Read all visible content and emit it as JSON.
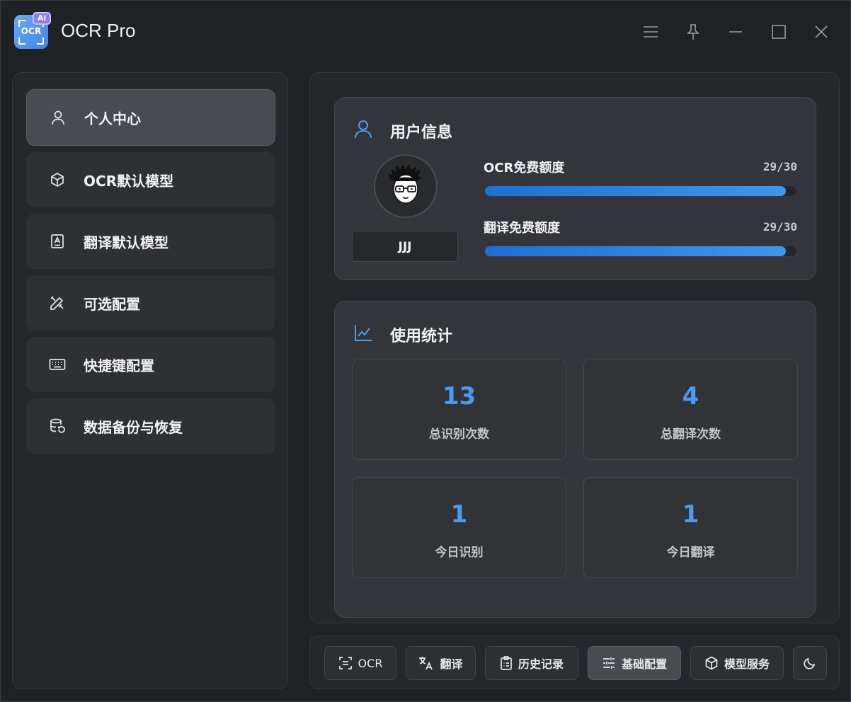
{
  "app": {
    "title": "OCR Pro",
    "logo_text": "OCR",
    "logo_badge": "Ai"
  },
  "sidebar": {
    "items": [
      {
        "label": "个人中心",
        "icon": "user-icon",
        "active": true
      },
      {
        "label": "OCR默认模型",
        "icon": "cube-icon",
        "active": false
      },
      {
        "label": "翻译默认模型",
        "icon": "document-a-icon",
        "active": false
      },
      {
        "label": "可选配置",
        "icon": "tools-icon",
        "active": false
      },
      {
        "label": "快捷键配置",
        "icon": "keyboard-icon",
        "active": false
      },
      {
        "label": "数据备份与恢复",
        "icon": "database-restore-icon",
        "active": false
      }
    ]
  },
  "user_info": {
    "title": "用户信息",
    "username": "JJJ",
    "ocr_quota": {
      "label": "OCR免费额度",
      "value": "29/30",
      "used": 29,
      "total": 30
    },
    "translate_quota": {
      "label": "翻译免费额度",
      "value": "29/30",
      "used": 29,
      "total": 30
    }
  },
  "usage_stats": {
    "title": "使用统计",
    "items": [
      {
        "value": "13",
        "label": "总识别次数"
      },
      {
        "value": "4",
        "label": "总翻译次数"
      },
      {
        "value": "1",
        "label": "今日识别"
      },
      {
        "value": "1",
        "label": "今日翻译"
      }
    ]
  },
  "bottom_bar": {
    "ocr": "OCR",
    "translate": "翻译",
    "history": "历史记录",
    "basic_config": "基础配置",
    "model_service": "模型服务"
  },
  "colors": {
    "accent": "#4a9bf0",
    "background": "#202124",
    "card": "#34353a"
  }
}
